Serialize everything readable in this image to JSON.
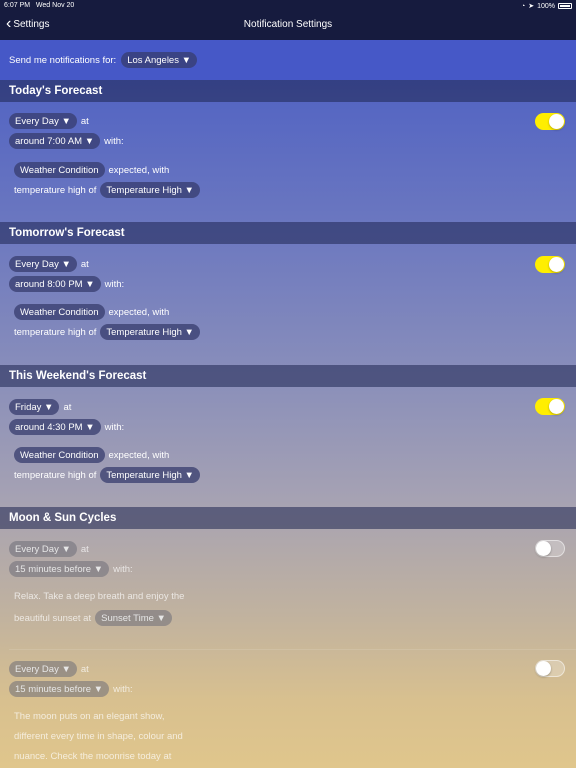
{
  "status": {
    "time": "6:07 PM",
    "date": "Wed Nov 20",
    "battery": "100%"
  },
  "nav": {
    "back_label": "Settings",
    "title": "Notification Settings"
  },
  "send": {
    "label": "Send me notifications for:",
    "city": "Los Angeles ▼"
  },
  "sections": [
    {
      "title": "Today's Forecast",
      "day": "Every Day ▼",
      "at": "at",
      "time": "around 7:00 AM ▼",
      "with": "with:",
      "condition": "Weather Condition",
      "expected": "expected, with",
      "temp_label": "temperature high of",
      "temp": "Temperature High ▼",
      "enabled": true
    },
    {
      "title": "Tomorrow's Forecast",
      "day": "Every Day ▼",
      "at": "at",
      "time": "around 8:00 PM ▼",
      "with": "with:",
      "condition": "Weather Condition",
      "expected": "expected, with",
      "temp_label": "temperature high of",
      "temp": "Temperature High ▼",
      "enabled": true
    },
    {
      "title": "This Weekend's Forecast",
      "day": "Friday ▼",
      "at": "at",
      "time": "around 4:30 PM ▼",
      "with": "with:",
      "condition": "Weather Condition",
      "expected": "expected, with",
      "temp_label": "temperature high of",
      "temp": "Temperature High ▼",
      "enabled": true
    }
  ],
  "cycles": {
    "title": "Moon & Sun Cycles",
    "sunset": {
      "day": "Every Day ▼",
      "at": "at",
      "time": "15 minutes before ▼",
      "with": "with:",
      "line1": "Relax. Take a deep breath and enjoy the",
      "line2": "beautiful sunset at",
      "pill": "Sunset Time ▼",
      "enabled": false
    },
    "moonrise": {
      "day": "Every Day ▼",
      "at": "at",
      "time": "15 minutes before ▼",
      "with": "with:",
      "line1": "The moon puts on an elegant show,",
      "line2": "different every time in shape, colour and",
      "line3": "nuance. Check the moonrise today at",
      "enabled": false
    }
  },
  "colors": {
    "toggle_on": "#ffee00",
    "nav_bg": "#161b3e"
  }
}
